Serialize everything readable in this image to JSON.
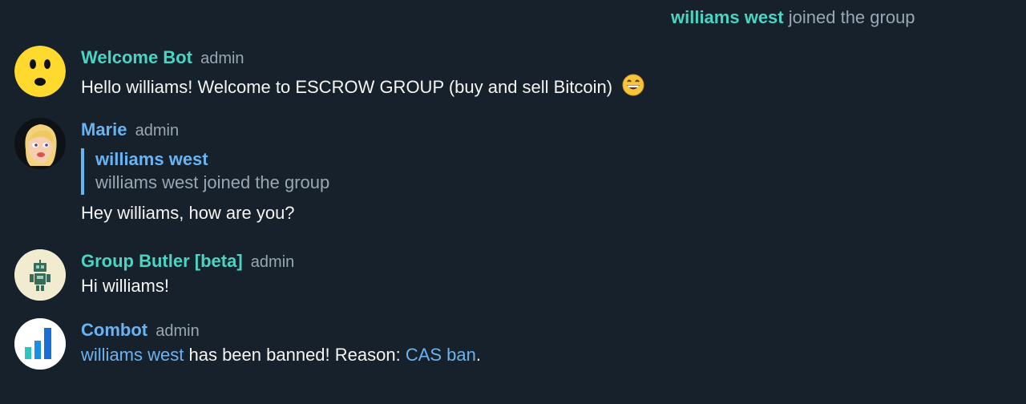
{
  "colors": {
    "background": "#17212b",
    "accent_teal": "#4bd3c3",
    "accent_blue": "#6ab3f3",
    "muted": "#9aa6b2",
    "text": "#f5f5f5"
  },
  "service_message": {
    "name": "williams west",
    "text": "joined the group"
  },
  "messages": [
    {
      "sender": "Welcome Bot",
      "role": "admin",
      "text": "Hello williams! Welcome to ESCROW GROUP (buy and sell Bitcoin)",
      "emoji": "grinning-face-icon"
    },
    {
      "sender": "Marie",
      "role": "admin",
      "reply_name": "williams west",
      "reply_text": "williams west joined the group",
      "text": "Hey williams, how are you?"
    },
    {
      "sender": "Group Butler [beta]",
      "role": "admin",
      "text": "Hi williams!"
    },
    {
      "sender": "Combot",
      "role": "admin",
      "mention": "williams west",
      "text_middle": "has been banned! Reason:",
      "reason_link": "CAS ban",
      "text_end": "."
    }
  ]
}
